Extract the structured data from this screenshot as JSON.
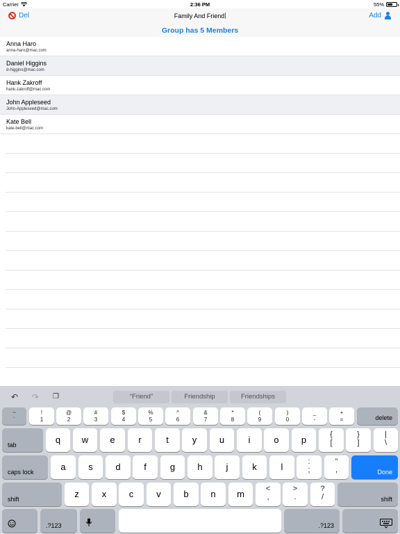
{
  "status_bar": {
    "carrier": "Carrier",
    "time": "2:36 PM",
    "battery": "55%",
    "battery_level": 0.55
  },
  "nav": {
    "left_label": "Del",
    "title": "Family And Friend",
    "right_label": "Add"
  },
  "group_header": "Group has 5 Members",
  "members": [
    {
      "name": "Anna Haro",
      "email": "anna-haro@mac.com"
    },
    {
      "name": "Daniel Higgins",
      "email": "d-higgins@mac.com"
    },
    {
      "name": "Hank Zakroff",
      "email": "hank-zakroff@mac.com"
    },
    {
      "name": "John Appleseed",
      "email": "John-Appleseed@mac.com"
    },
    {
      "name": "Kate Bell",
      "email": "kate-bell@mac.com"
    }
  ],
  "keyboard": {
    "suggestions": [
      "“Friend”",
      "Friendship",
      "Friendships"
    ],
    "number_row": [
      {
        "top": "~",
        "bottom": "`"
      },
      {
        "top": "!",
        "bottom": "1"
      },
      {
        "top": "@",
        "bottom": "2"
      },
      {
        "top": "#",
        "bottom": "3"
      },
      {
        "top": "$",
        "bottom": "4"
      },
      {
        "top": "%",
        "bottom": "5"
      },
      {
        "top": "^",
        "bottom": "6"
      },
      {
        "top": "&",
        "bottom": "7"
      },
      {
        "top": "*",
        "bottom": "8"
      },
      {
        "top": "(",
        "bottom": "9"
      },
      {
        "top": ")",
        "bottom": "0"
      },
      {
        "top": "_",
        "bottom": "-"
      },
      {
        "top": "+",
        "bottom": "="
      }
    ],
    "delete": "delete",
    "tab": "tab",
    "qrow": [
      "q",
      "w",
      "e",
      "r",
      "t",
      "y",
      "u",
      "i",
      "o",
      "p"
    ],
    "qrow_punct": [
      {
        "top": "{",
        "bottom": "["
      },
      {
        "top": "}",
        "bottom": "]"
      },
      {
        "top": "|",
        "bottom": "\\"
      }
    ],
    "caps_lock": "caps lock",
    "arow": [
      "a",
      "s",
      "d",
      "f",
      "g",
      "h",
      "j",
      "k",
      "l"
    ],
    "arow_punct": [
      {
        "top": ":",
        "bottom": ";"
      },
      {
        "top": "”",
        "bottom": ","
      }
    ],
    "done": "Done",
    "shift": "shift",
    "zrow": [
      "z",
      "x",
      "c",
      "v",
      "b",
      "n",
      "m"
    ],
    "zrow_punct": [
      {
        "top": "<",
        "bottom": ","
      },
      {
        "top": ">",
        "bottom": "."
      },
      {
        "top": "?",
        "bottom": "/"
      }
    ],
    "numbers_key": ".?123"
  }
}
